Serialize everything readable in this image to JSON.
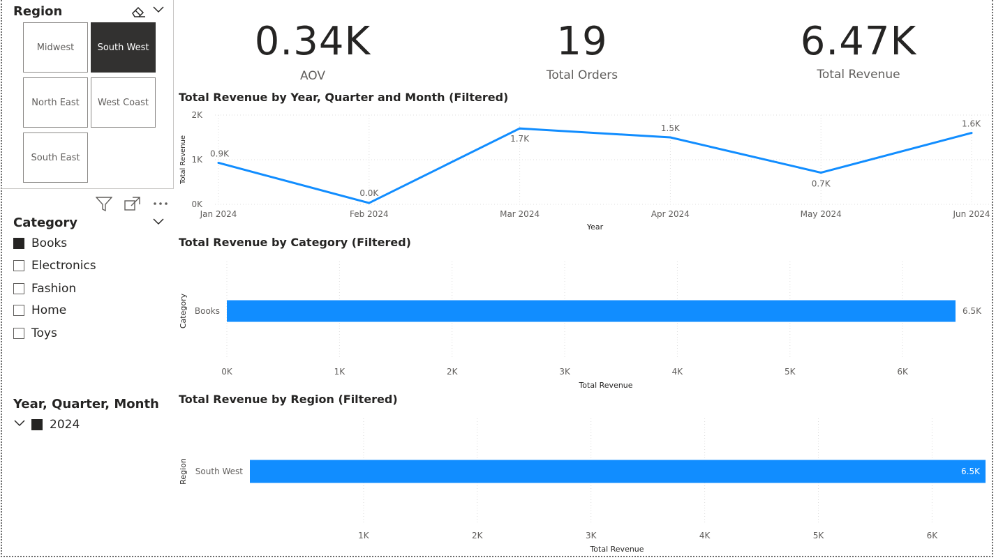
{
  "region_slicer": {
    "title": "Region",
    "tiles": [
      {
        "label": "Midwest",
        "selected": false
      },
      {
        "label": "South West",
        "selected": true
      },
      {
        "label": "North East",
        "selected": false
      },
      {
        "label": "West Coast",
        "selected": false
      },
      {
        "label": "South East",
        "selected": false
      }
    ]
  },
  "category_slicer": {
    "title": "Category",
    "items": [
      {
        "label": "Books",
        "checked": true
      },
      {
        "label": "Electronics",
        "checked": false
      },
      {
        "label": "Fashion",
        "checked": false
      },
      {
        "label": "Home",
        "checked": false
      },
      {
        "label": "Toys",
        "checked": false
      }
    ]
  },
  "date_slicer": {
    "title": "Year, Quarter, Month",
    "items": [
      {
        "label": "2024",
        "checked": true
      }
    ]
  },
  "kpis": [
    {
      "value": "0.34K",
      "label": "AOV"
    },
    {
      "value": "19",
      "label": "Total Orders"
    },
    {
      "value": "6.47K",
      "label": "Total Revenue"
    }
  ],
  "colors": {
    "accent": "#118DFF",
    "selected_tile": "#323130"
  },
  "icons": [
    "eraser-icon",
    "chevron-down-icon",
    "filter-icon",
    "focus-mode-icon",
    "more-options-icon"
  ],
  "chart_data": [
    {
      "type": "line",
      "title": "Total Revenue by Year, Quarter and Month (Filtered)",
      "xlabel": "Year",
      "ylabel": "Total Revenue",
      "categories": [
        "Jan 2024",
        "Feb 2024",
        "Mar 2024",
        "Apr 2024",
        "May 2024",
        "Jun 2024"
      ],
      "values": [
        930,
        30,
        1700,
        1500,
        710,
        1600
      ],
      "data_labels": [
        "0.9K",
        "0.0K",
        "1.7K",
        "1.5K",
        "0.7K",
        "1.6K"
      ],
      "ylim": [
        0,
        2000
      ],
      "yticks": [
        "0K",
        "1K",
        "2K"
      ],
      "grid": true
    },
    {
      "type": "bar",
      "orientation": "horizontal",
      "title": "Total Revenue by Category (Filtered)",
      "xlabel": "Total Revenue",
      "ylabel": "Category",
      "categories": [
        "Books"
      ],
      "values": [
        6470
      ],
      "data_labels": [
        "6.5K"
      ],
      "xlim": [
        0,
        6470
      ],
      "xticks": [
        "0K",
        "1K",
        "2K",
        "3K",
        "4K",
        "5K",
        "6K"
      ],
      "grid": true
    },
    {
      "type": "bar",
      "orientation": "horizontal",
      "title": "Total Revenue by Region (Filtered)",
      "xlabel": "Total Revenue",
      "ylabel": "Region",
      "categories": [
        "South West"
      ],
      "values": [
        6470
      ],
      "data_labels": [
        "6.5K"
      ],
      "xlim": [
        0,
        6470
      ],
      "xticks": [
        "1K",
        "2K",
        "3K",
        "4K",
        "5K",
        "6K"
      ],
      "grid": true
    }
  ]
}
